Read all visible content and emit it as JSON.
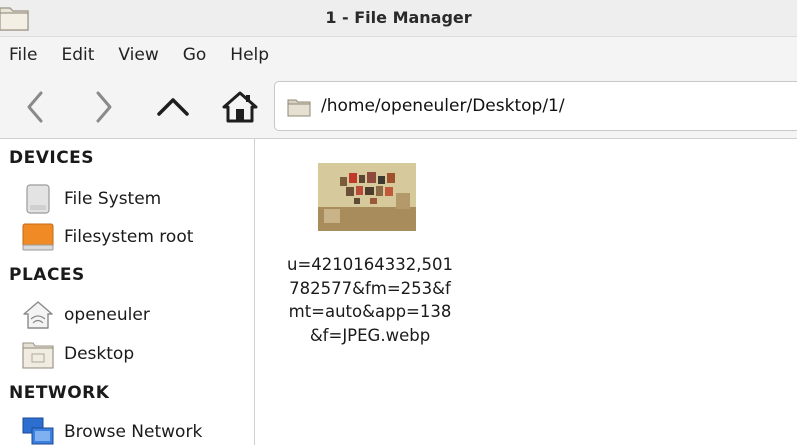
{
  "window": {
    "title": "1 - File Manager"
  },
  "menu": {
    "items": [
      "File",
      "Edit",
      "View",
      "Go",
      "Help"
    ]
  },
  "toolbar": {
    "icons": [
      "back-icon",
      "forward-icon",
      "up-icon",
      "home-icon"
    ],
    "path": "/home/openeuler/Desktop/1/"
  },
  "sidebar": {
    "devices_header": "DEVICES",
    "devices": [
      {
        "label": "File System",
        "icon": "drive-icon"
      },
      {
        "label": "Filesystem root",
        "icon": "root-drive-icon"
      }
    ],
    "places_header": "PLACES",
    "places": [
      {
        "label": "openeuler",
        "icon": "home-folder-icon"
      },
      {
        "label": "Desktop",
        "icon": "desktop-folder-icon"
      }
    ],
    "network_header": "NETWORK",
    "network": [
      {
        "label": "Browse Network",
        "icon": "network-icon"
      }
    ]
  },
  "files": [
    {
      "name_lines": [
        "u=4210164332,501",
        "782577&fm=253&f",
        "mt=auto&app=138",
        "&f=JPEG.webp"
      ]
    }
  ],
  "colors": {
    "titlebar_bg": "#eeeeee",
    "toolbar_bg": "#f4f4f4",
    "root_icon": "#f08a24",
    "network_icon": "#2d6fd1"
  }
}
